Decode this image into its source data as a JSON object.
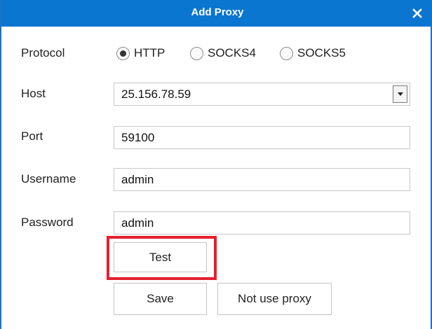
{
  "dialog": {
    "title": "Add Proxy",
    "close_icon": "close-icon"
  },
  "colors": {
    "titlebar": "#0b76d0",
    "border": "#1a73c9",
    "highlight": "#e4202e"
  },
  "form": {
    "protocol_label": "Protocol",
    "protocol_options": [
      "HTTP",
      "SOCKS4",
      "SOCKS5"
    ],
    "protocol_selected": "HTTP",
    "host_label": "Host",
    "host_value": "25.156.78.59",
    "port_label": "Port",
    "port_value": "59100",
    "username_label": "Username",
    "username_value": "admin",
    "password_label": "Password",
    "password_value": "admin"
  },
  "buttons": {
    "test_label": "Test",
    "save_label": "Save",
    "not_use_proxy_label": "Not use proxy"
  }
}
